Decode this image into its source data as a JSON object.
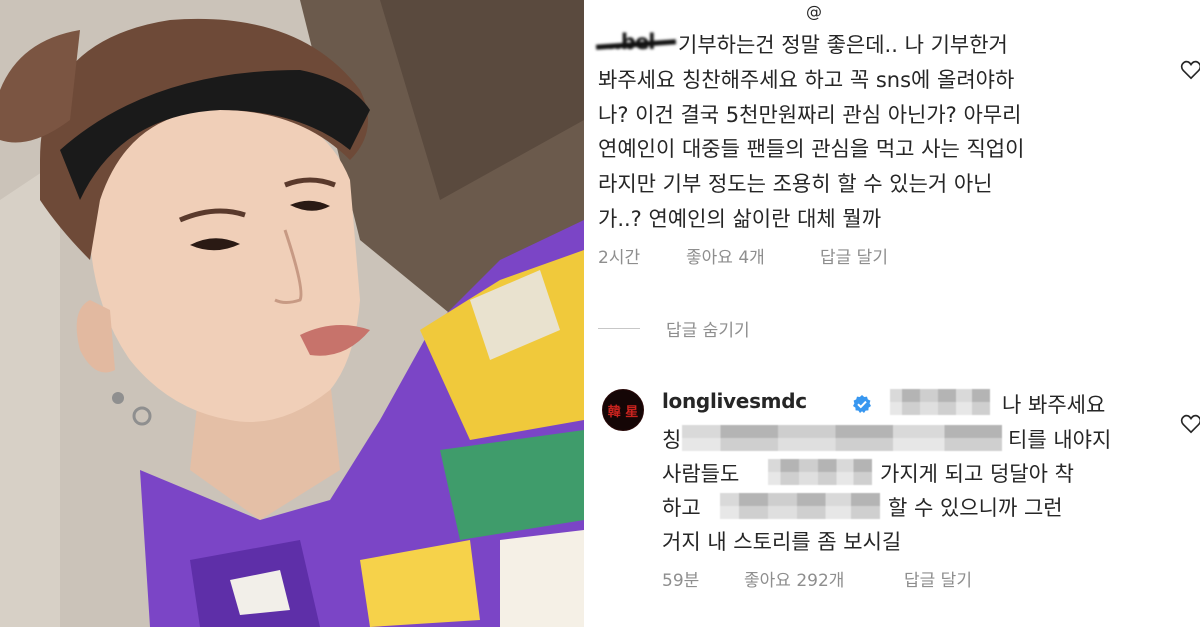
{
  "comment1": {
    "username": "...bel",
    "lines": [
      "기부하는건 정말 좋은데.. 나 기부한거",
      "봐주세요 칭찬해주세요 하고 꼭 sns에 올려야하",
      "나? 이건 결국 5천만원짜리 관심 아닌가? 아무리",
      "연예인이 대중들 팬들의 관심을 먹고 사는 직업이",
      "라지만 기부 정도는 조용히 할 수 있는거 아닌",
      "가..? 연예인의 삶이란 대체 뭘까"
    ],
    "time": "2시간",
    "likes": "좋아요 4개",
    "reply": "답글 달기"
  },
  "hide_replies": "답글 숨기기",
  "comment2": {
    "avatar_text": "韓 星",
    "username": "longlivesmdc",
    "line1_tail": "나 봐주세요",
    "line2_head": "칭",
    "line2_tail": "티를 내야지",
    "line3_head": "사람들도",
    "line3_tail": "가지게 되고 덩달아 착",
    "line4_head": "하고",
    "line4_tail": "할 수 있으니까 그런",
    "line5": "거지 내 스토리를 좀 보시길",
    "time": "59분",
    "likes": "좋아요 292개",
    "reply": "답글 달기"
  },
  "icons": {
    "like": "heart-icon",
    "verified": "verified-badge-icon"
  },
  "colors": {
    "text": "#262626",
    "meta": "#8e8e8e",
    "verified": "#3897f0",
    "shirt": "#7b45c6"
  }
}
